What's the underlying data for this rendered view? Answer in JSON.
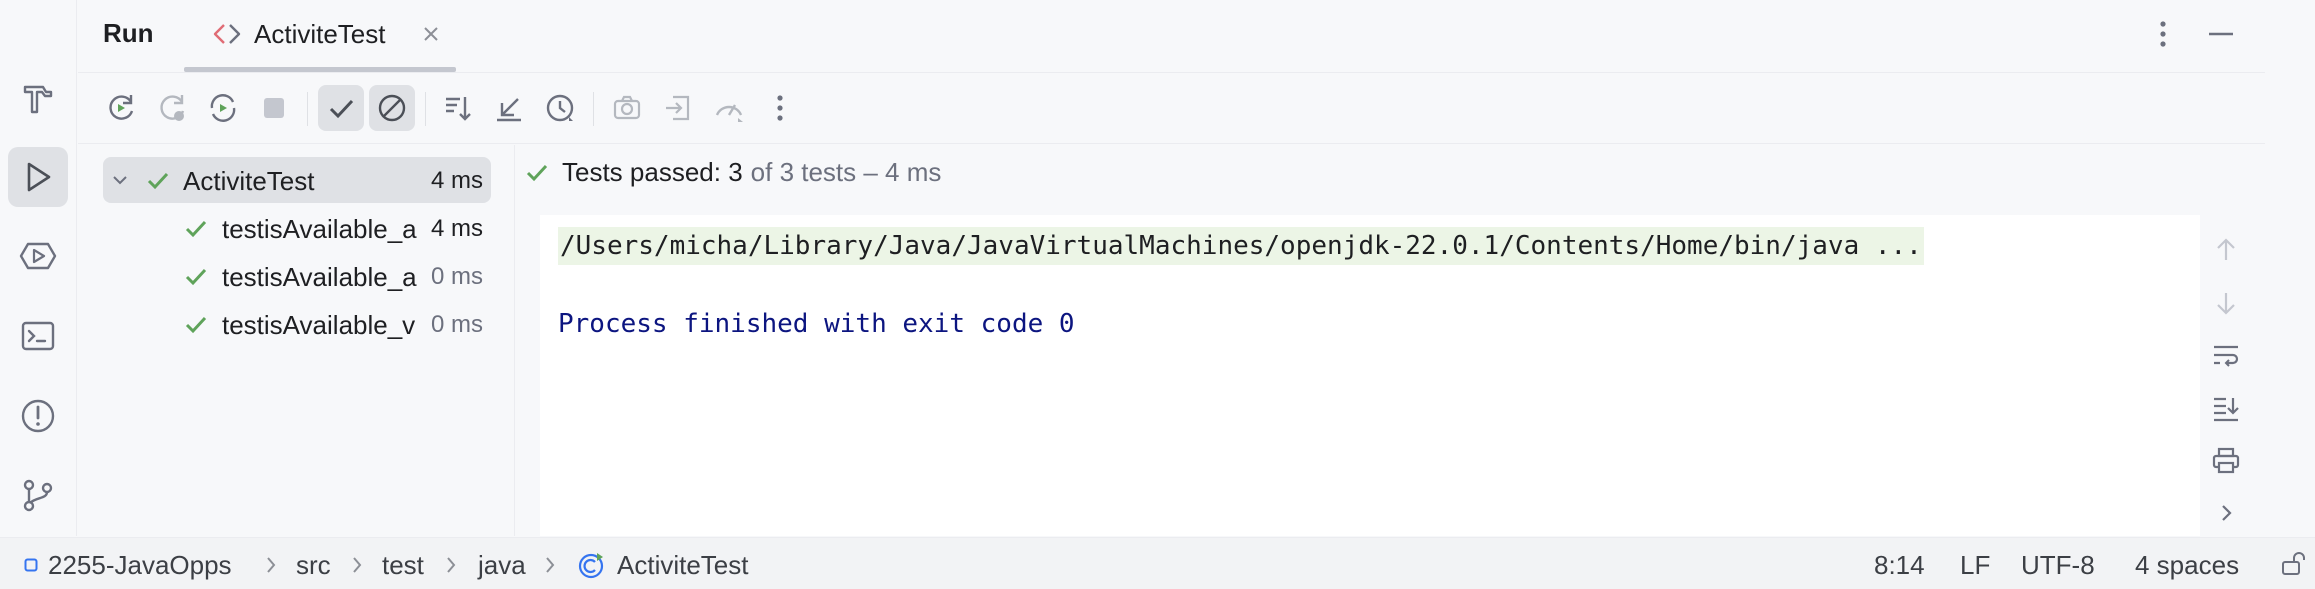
{
  "header": {
    "title": "Run",
    "tab": {
      "label": "ActiviteTest"
    }
  },
  "left_strip": {
    "items": [
      "build-icon",
      "run-icon",
      "services-icon",
      "terminal-icon",
      "problems-icon",
      "git-icon"
    ],
    "active": "run-icon"
  },
  "toolbar": {
    "buttons": [
      "rerun",
      "rerun-failed",
      "toggle-auto-test",
      "stop",
      "show-passed",
      "show-ignored",
      "sort",
      "collapse",
      "history",
      "screenshot",
      "import",
      "coverage",
      "more"
    ]
  },
  "tree": {
    "root": {
      "name": "ActiviteTest",
      "time": "4 ms"
    },
    "children": [
      {
        "name": "testisAvailable_a",
        "time": "4 ms"
      },
      {
        "name": "testisAvailable_a",
        "time": "0 ms"
      },
      {
        "name": "testisAvailable_v",
        "time": "0 ms"
      }
    ]
  },
  "console": {
    "status_passed": "Tests passed: 3",
    "status_rest": "of 3 tests – 4 ms",
    "command": "/Users/micha/Library/Java/JavaVirtualMachines/openjdk-22.0.1/Contents/Home/bin/java ...",
    "exit_message": "Process finished with exit code 0"
  },
  "statusbar": {
    "breadcrumbs": [
      "2255-JavaOpps",
      "src",
      "test",
      "java",
      "ActiviteTest"
    ],
    "position": "8:14",
    "line_ending": "LF",
    "encoding": "UTF-8",
    "indent": "4 spaces"
  },
  "colors": {
    "accent_green": "#5fa35a",
    "exit_blue": "#0c1580",
    "command_bg": "#ecf5e6"
  }
}
